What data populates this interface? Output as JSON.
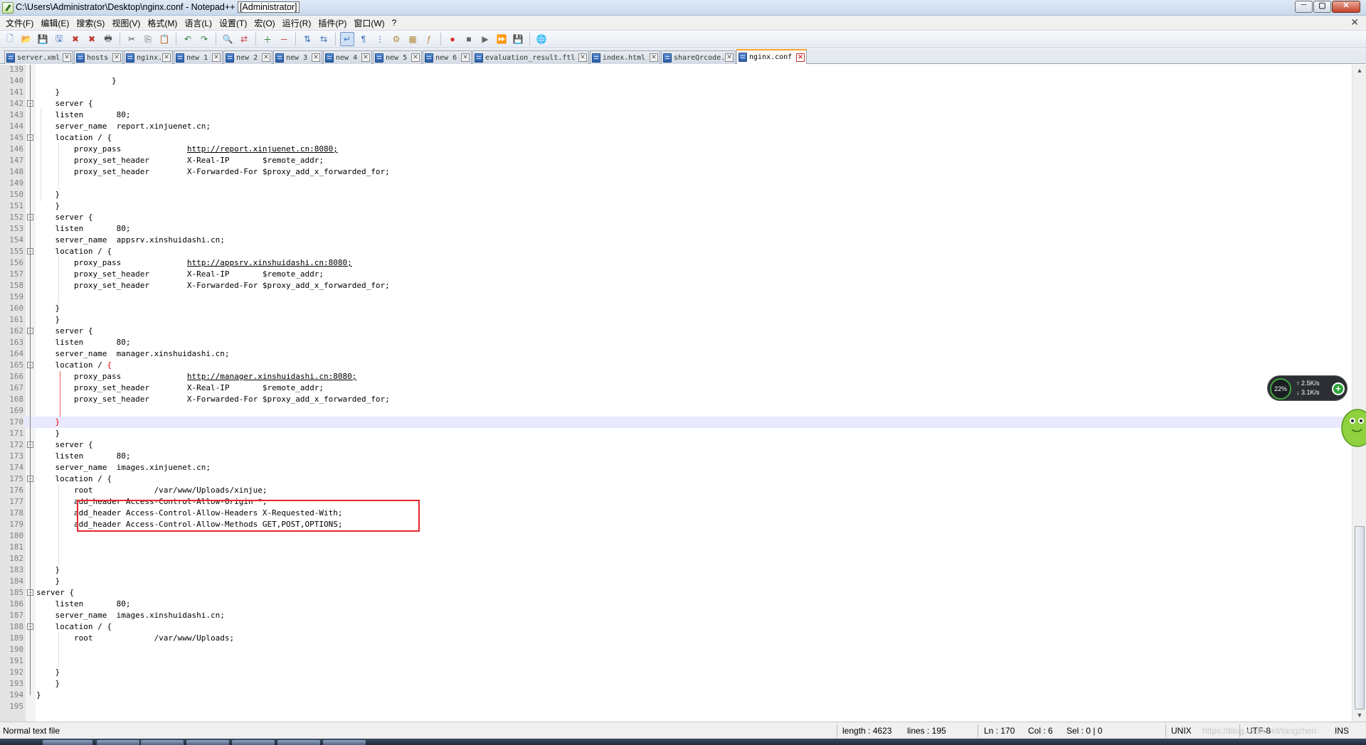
{
  "window": {
    "title_prefix": "C:\\Users\\Administrator\\Desktop\\nginx.conf - Notepad++ ",
    "title_admin": "[Administrator]",
    "minimize_glyph": "─",
    "maximize_glyph": "▢",
    "close_glyph": "✕"
  },
  "menu": {
    "items": [
      "文件(F)",
      "编辑(E)",
      "搜索(S)",
      "视图(V)",
      "格式(M)",
      "语言(L)",
      "设置(T)",
      "宏(O)",
      "运行(R)",
      "插件(P)",
      "窗口(W)",
      "?"
    ],
    "close_glyph": "✕"
  },
  "toolbar": {
    "icons": [
      "new-file-icon",
      "open-file-icon",
      "save-icon",
      "save-all-icon",
      "close-icon",
      "close-all-icon",
      "print-icon",
      "cut-icon",
      "copy-icon",
      "paste-icon",
      "undo-icon",
      "redo-icon",
      "find-icon",
      "replace-icon",
      "zoom-in-icon",
      "zoom-out-icon",
      "sync-vertical-icon",
      "sync-horizontal-icon",
      "word-wrap-icon",
      "show-all-chars-icon",
      "indent-guide-icon",
      "user-lang-icon",
      "doc-map-icon",
      "function-list-icon",
      "record-macro-icon",
      "stop-record-icon",
      "play-macro-icon",
      "play-multiple-icon",
      "save-macro-icon",
      "launch-browser-icon"
    ]
  },
  "tabs": [
    {
      "label": "server.xml",
      "active": false
    },
    {
      "label": "hosts",
      "active": false
    },
    {
      "label": "nginx.conf",
      "active": false
    },
    {
      "label": "new 1",
      "active": false
    },
    {
      "label": "new 2",
      "active": false
    },
    {
      "label": "new 3",
      "active": false
    },
    {
      "label": "new 4",
      "active": false
    },
    {
      "label": "new 5",
      "active": false
    },
    {
      "label": "new 6",
      "active": false
    },
    {
      "label": "evaluation_result.ftl",
      "active": false
    },
    {
      "label": "index.html",
      "active": false
    },
    {
      "label": "shareQrcode.js",
      "active": false
    },
    {
      "label": "nginx.conf",
      "active": true
    }
  ],
  "editor": {
    "current_line": "170",
    "lines": [
      {
        "n": "139",
        "t": ""
      },
      {
        "n": "140",
        "t": "                }"
      },
      {
        "n": "141",
        "t": "    }"
      },
      {
        "n": "142",
        "t": "    server {"
      },
      {
        "n": "143",
        "t": "    listen       80;"
      },
      {
        "n": "144",
        "t": "    server_name  report.xinjuenet.cn;"
      },
      {
        "n": "145",
        "t": "    location / {"
      },
      {
        "n": "146",
        "t": "        proxy_pass              ",
        "url": "http://report.xinjuenet.cn:8080;"
      },
      {
        "n": "147",
        "t": "        proxy_set_header        X-Real-IP       $remote_addr;"
      },
      {
        "n": "148",
        "t": "        proxy_set_header        X-Forwarded-For $proxy_add_x_forwarded_for;"
      },
      {
        "n": "149",
        "t": ""
      },
      {
        "n": "150",
        "t": "    }"
      },
      {
        "n": "151",
        "t": "    }"
      },
      {
        "n": "152",
        "t": "    server {"
      },
      {
        "n": "153",
        "t": "    listen       80;"
      },
      {
        "n": "154",
        "t": "    server_name  appsrv.xinshuidashi.cn;"
      },
      {
        "n": "155",
        "t": "    location / {"
      },
      {
        "n": "156",
        "t": "        proxy_pass              ",
        "url": "http://appsrv.xinshuidashi.cn:8080;"
      },
      {
        "n": "157",
        "t": "        proxy_set_header        X-Real-IP       $remote_addr;"
      },
      {
        "n": "158",
        "t": "        proxy_set_header        X-Forwarded-For $proxy_add_x_forwarded_for;"
      },
      {
        "n": "159",
        "t": ""
      },
      {
        "n": "160",
        "t": "    }"
      },
      {
        "n": "161",
        "t": "    }"
      },
      {
        "n": "162",
        "t": "    server {"
      },
      {
        "n": "163",
        "t": "    listen       80;"
      },
      {
        "n": "164",
        "t": "    server_name  manager.xinshuidashi.cn;"
      },
      {
        "n": "165",
        "t": "    location / ",
        "hl": "{"
      },
      {
        "n": "166",
        "t": "        proxy_pass              ",
        "url": "http://manager.xinshuidashi.cn:8080;"
      },
      {
        "n": "167",
        "t": "        proxy_set_header        X-Real-IP       $remote_addr;"
      },
      {
        "n": "168",
        "t": "        proxy_set_header        X-Forwarded-For $proxy_add_x_forwarded_for;"
      },
      {
        "n": "169",
        "t": ""
      },
      {
        "n": "170",
        "t": "    ",
        "hl": "}"
      },
      {
        "n": "171",
        "t": "    }"
      },
      {
        "n": "172",
        "t": "    server {"
      },
      {
        "n": "173",
        "t": "    listen       80;"
      },
      {
        "n": "174",
        "t": "    server_name  images.xinjuenet.cn;"
      },
      {
        "n": "175",
        "t": "    location / {"
      },
      {
        "n": "176",
        "t": "        root             /var/www/Uploads/xinjue;"
      },
      {
        "n": "177",
        "t": "        add_header Access-Control-Allow-Origin *;"
      },
      {
        "n": "178",
        "t": "        add_header Access-Control-Allow-Headers X-Requested-With;"
      },
      {
        "n": "179",
        "t": "        add_header Access-Control-Allow-Methods GET,POST,OPTIONS;"
      },
      {
        "n": "180",
        "t": ""
      },
      {
        "n": "181",
        "t": ""
      },
      {
        "n": "182",
        "t": ""
      },
      {
        "n": "183",
        "t": "    }"
      },
      {
        "n": "184",
        "t": "    }"
      },
      {
        "n": "185",
        "t": "server {"
      },
      {
        "n": "186",
        "t": "    listen       80;"
      },
      {
        "n": "187",
        "t": "    server_name  images.xinshuidashi.cn;"
      },
      {
        "n": "188",
        "t": "    location / {"
      },
      {
        "n": "189",
        "t": "        root             /var/www/Uploads;"
      },
      {
        "n": "190",
        "t": ""
      },
      {
        "n": "191",
        "t": ""
      },
      {
        "n": "192",
        "t": "    }"
      },
      {
        "n": "193",
        "t": "    }"
      },
      {
        "n": "194",
        "t": "}"
      },
      {
        "n": "195",
        "t": ""
      }
    ]
  },
  "network_widget": {
    "percent": "22%",
    "upload": "2.5K/s",
    "download": "3.1K/s",
    "plus": "+"
  },
  "statusbar": {
    "file_type": "Normal text file",
    "length": "length : 4623",
    "lines": "lines : 195",
    "ln": "Ln : 170",
    "col": "Col : 6",
    "sel": "Sel : 0 | 0",
    "eol": "UNIX",
    "encoding": "UTF-8",
    "mode": "INS",
    "watermark": "https://blog.csdn.net/tangzhen"
  },
  "colors": {
    "highlight_box": "#e5262b",
    "current_line": "#e8e8ff",
    "active_tab_accent": "#f4a32b"
  }
}
